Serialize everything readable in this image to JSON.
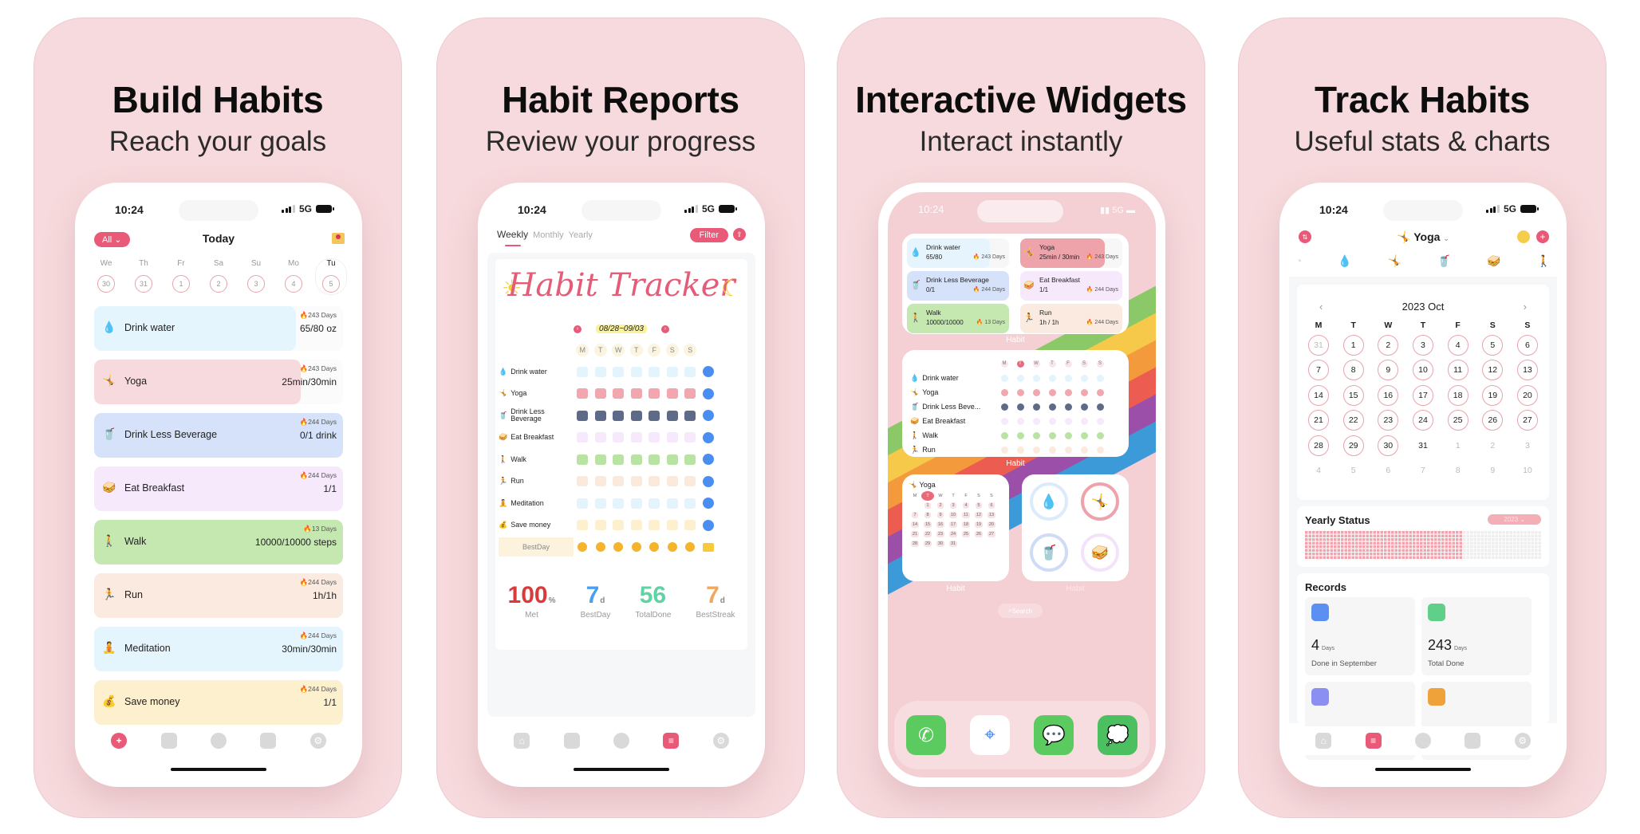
{
  "panels": [
    {
      "title": "Build Habits",
      "subtitle": "Reach your goals"
    },
    {
      "title": "Habit Reports",
      "subtitle": "Review your progress"
    },
    {
      "title": "Interactive Widgets",
      "subtitle": "Interact instantly"
    },
    {
      "title": "Track Habits",
      "subtitle": "Useful stats & charts"
    }
  ],
  "status_bar": {
    "time": "10:24",
    "network": "5G"
  },
  "colors": {
    "accent": "#e85a77",
    "background": "#f7dadd"
  },
  "today_screen": {
    "filter_label": "All",
    "title": "Today",
    "mail_icon": "love-letter-icon",
    "week": [
      {
        "day": "We",
        "date": "30"
      },
      {
        "day": "Th",
        "date": "31"
      },
      {
        "day": "Fr",
        "date": "1"
      },
      {
        "day": "Sa",
        "date": "2"
      },
      {
        "day": "Su",
        "date": "3"
      },
      {
        "day": "Mo",
        "date": "4"
      },
      {
        "day": "Tu",
        "date": "5"
      }
    ],
    "habits": [
      {
        "icon": "💧",
        "name": "Drink water",
        "streak": "243 Days",
        "value": "65/80 oz",
        "progress": 0.81,
        "color": "#e5f5fd"
      },
      {
        "icon": "🤸",
        "name": "Yoga",
        "streak": "243 Days",
        "value": "25min/30min",
        "progress": 0.83,
        "color": "#f7dadd"
      },
      {
        "icon": "🥤",
        "name": "Drink Less Beverage",
        "streak": "244 Days",
        "value": "0/1 drink",
        "progress": 1.0,
        "color": "#d5e2f9"
      },
      {
        "icon": "🥪",
        "name": "Eat Breakfast",
        "streak": "244 Days",
        "value": "1/1",
        "progress": 1.0,
        "color": "#f6e9fb"
      },
      {
        "icon": "🚶",
        "name": "Walk",
        "streak": "13 Days",
        "value": "10000/10000 steps",
        "progress": 1.0,
        "color": "#c5e8b1"
      },
      {
        "icon": "🏃",
        "name": "Run",
        "streak": "244 Days",
        "value": "1h/1h",
        "progress": 1.0,
        "color": "#fbeadf"
      },
      {
        "icon": "🧘",
        "name": "Meditation",
        "streak": "244 Days",
        "value": "30min/30min",
        "progress": 1.0,
        "color": "#e5f5fd"
      },
      {
        "icon": "💰",
        "name": "Save money",
        "streak": "244 Days",
        "value": "1/1",
        "progress": 1.0,
        "color": "#fdf0cf"
      }
    ]
  },
  "report_screen": {
    "tabs": [
      "Weekly",
      "Monthly",
      "Yearly"
    ],
    "filter_label": "Filter",
    "tracker_title": "Habit Tracker",
    "date_range": "08/28~09/03",
    "days": [
      "M",
      "T",
      "W",
      "T",
      "F",
      "S",
      "S"
    ],
    "rows": [
      {
        "icon": "💧",
        "name": "Drink water",
        "color": "#e4f4fc"
      },
      {
        "icon": "🤸",
        "name": "Yoga",
        "color": "#f1a7ad"
      },
      {
        "icon": "🥤",
        "name": "Drink Less Beverage",
        "color": "#5d6b89"
      },
      {
        "icon": "🥪",
        "name": "Eat Breakfast",
        "color": "#f6e9fb"
      },
      {
        "icon": "🚶",
        "name": "Walk",
        "color": "#b8e3a3"
      },
      {
        "icon": "🏃",
        "name": "Run",
        "color": "#fbeadc"
      },
      {
        "icon": "🧘",
        "name": "Meditation",
        "color": "#e4f4fc"
      },
      {
        "icon": "💰",
        "name": "Save money",
        "color": "#fdf0cf"
      }
    ],
    "best_day_label": "BestDay",
    "stats": [
      {
        "value": "100",
        "unit": "%",
        "label": "Met",
        "color": "#d93a3a"
      },
      {
        "value": "7",
        "unit": "d",
        "label": "BestDay",
        "color": "#4b9ff0"
      },
      {
        "value": "56",
        "unit": "",
        "label": "TotalDone",
        "color": "#5fd3a3"
      },
      {
        "value": "7",
        "unit": "d",
        "label": "BestStreak",
        "color": "#f0a760"
      }
    ]
  },
  "widgets_screen": {
    "widget_label": "Habit",
    "small_widgets": [
      {
        "icon": "💧",
        "name": "Drink water",
        "value": "65/80",
        "streak": "243 Days",
        "color": "#e6f5fd",
        "progress": 0.81
      },
      {
        "icon": "🤸",
        "name": "Yoga",
        "value": "25min / 30min",
        "streak": "243 Days",
        "color": "#eea3ab",
        "progress": 0.83
      },
      {
        "icon": "🥤",
        "name": "Drink Less Beverage",
        "value": "0/1",
        "streak": "244 Days",
        "color": "#d5e2f9",
        "progress": 1.0
      },
      {
        "icon": "🥪",
        "name": "Eat Breakfast",
        "value": "1/1",
        "streak": "244 Days",
        "color": "#f6e9fb",
        "progress": 1.0
      },
      {
        "icon": "🚶",
        "name": "Walk",
        "value": "10000/10000",
        "streak": "13 Days",
        "color": "#c5e8b1",
        "progress": 1.0
      },
      {
        "icon": "🏃",
        "name": "Run",
        "value": "1h / 1h",
        "streak": "244 Days",
        "color": "#fbeadf",
        "progress": 1.0
      }
    ],
    "weekly_widget": {
      "days": [
        "M",
        "T",
        "W",
        "T",
        "F",
        "S",
        "S"
      ],
      "today_index": 1,
      "rows": [
        {
          "icon": "💧",
          "name": "Drink water",
          "color": "#e4f4fc"
        },
        {
          "icon": "🤸",
          "name": "Yoga",
          "color": "#f1a7ad"
        },
        {
          "icon": "🥤",
          "name": "Drink Less Beve...",
          "color": "#5d6b89"
        },
        {
          "icon": "🥪",
          "name": "Eat Breakfast",
          "color": "#f6e9fb"
        },
        {
          "icon": "🚶",
          "name": "Walk",
          "color": "#b8e3a3"
        },
        {
          "icon": "🏃",
          "name": "Run",
          "color": "#fbeadc"
        }
      ]
    },
    "calendar_widget": {
      "habit": "Yoga",
      "icon": "🤸",
      "days": [
        "M",
        "T",
        "W",
        "T",
        "F",
        "S",
        "S"
      ],
      "weeks": [
        [
          "",
          "1",
          "2",
          "3",
          "4",
          "5",
          "6"
        ],
        [
          "7",
          "8",
          "9",
          "10",
          "11",
          "12",
          "13"
        ],
        [
          "14",
          "15",
          "16",
          "17",
          "18",
          "19",
          "20"
        ],
        [
          "21",
          "22",
          "23",
          "24",
          "25",
          "26",
          "27"
        ],
        [
          "28",
          "29",
          "30",
          "31",
          "",
          "",
          ""
        ]
      ]
    },
    "ring_widget": [
      {
        "icon": "💧",
        "color": "#dcebfb",
        "progress": 0.81
      },
      {
        "icon": "🤸",
        "color": "#eea3ab",
        "progress": 0.83
      },
      {
        "icon": "🥤",
        "color": "#cfdcf6",
        "progress": 1.0
      },
      {
        "icon": "🥪",
        "color": "#f3e3fa",
        "progress": 1.0
      }
    ],
    "search_label": "Search",
    "dock_apps": [
      {
        "name": "Phone",
        "glyph": "✆",
        "color": "#5ccb5f"
      },
      {
        "name": "Safari",
        "glyph": "⌖",
        "color": "#2f7ef0"
      },
      {
        "name": "Messages",
        "glyph": "💬",
        "color": "#5ccb5f"
      },
      {
        "name": "WeChat",
        "glyph": "💭",
        "color": "#4cc060"
      }
    ]
  },
  "stats_screen": {
    "habit_title": "Yoga",
    "habit_icon": "🤸",
    "habit_tabs": [
      "◔",
      "💧",
      "🤸",
      "🥤",
      "🥪",
      "🚶"
    ],
    "month_label": "2023 Oct",
    "days": [
      "M",
      "T",
      "W",
      "T",
      "F",
      "S",
      "S"
    ],
    "calendar": [
      [
        {
          "d": "31",
          "s": "done-out"
        },
        {
          "d": "1",
          "s": "done"
        },
        {
          "d": "2",
          "s": "done"
        },
        {
          "d": "3",
          "s": "done"
        },
        {
          "d": "4",
          "s": "done"
        },
        {
          "d": "5",
          "s": "done"
        },
        {
          "d": "6",
          "s": "done"
        }
      ],
      [
        {
          "d": "7",
          "s": "done"
        },
        {
          "d": "8",
          "s": "done"
        },
        {
          "d": "9",
          "s": "done"
        },
        {
          "d": "10",
          "s": "done"
        },
        {
          "d": "11",
          "s": "done"
        },
        {
          "d": "12",
          "s": "done"
        },
        {
          "d": "13",
          "s": "done"
        }
      ],
      [
        {
          "d": "14",
          "s": "done"
        },
        {
          "d": "15",
          "s": "done"
        },
        {
          "d": "16",
          "s": "done"
        },
        {
          "d": "17",
          "s": "done"
        },
        {
          "d": "18",
          "s": "done"
        },
        {
          "d": "19",
          "s": "done"
        },
        {
          "d": "20",
          "s": "done"
        }
      ],
      [
        {
          "d": "21",
          "s": "done"
        },
        {
          "d": "22",
          "s": "done"
        },
        {
          "d": "23",
          "s": "done"
        },
        {
          "d": "24",
          "s": "done"
        },
        {
          "d": "25",
          "s": "done"
        },
        {
          "d": "26",
          "s": "done"
        },
        {
          "d": "27",
          "s": "done"
        }
      ],
      [
        {
          "d": "28",
          "s": "done"
        },
        {
          "d": "29",
          "s": "done"
        },
        {
          "d": "30",
          "s": "done"
        },
        {
          "d": "31",
          "s": "none"
        },
        {
          "d": "1",
          "s": "out"
        },
        {
          "d": "2",
          "s": "out"
        },
        {
          "d": "3",
          "s": "out"
        }
      ],
      [
        {
          "d": "4",
          "s": "out"
        },
        {
          "d": "5",
          "s": "out"
        },
        {
          "d": "6",
          "s": "out"
        },
        {
          "d": "7",
          "s": "out"
        },
        {
          "d": "8",
          "s": "out"
        },
        {
          "d": "9",
          "s": "out"
        },
        {
          "d": "10",
          "s": "out"
        }
      ]
    ],
    "yearly_status": {
      "title": "Yearly Status",
      "year": "2023",
      "done_fraction": 0.67
    },
    "records": {
      "title": "Records",
      "items": [
        {
          "value": "4",
          "unit": "Days",
          "label": "Done in September",
          "icon_color": "#5b8ff2"
        },
        {
          "value": "243",
          "unit": "Days",
          "label": "Total Done",
          "icon_color": "#5fcf8a"
        },
        {
          "value": "",
          "unit": "",
          "label": "",
          "icon_color": "#8c8ff2"
        },
        {
          "value": "",
          "unit": "",
          "label": "",
          "icon_color": "#f0a23a"
        }
      ]
    }
  },
  "nav_icons": [
    "home-icon",
    "notes-icon",
    "friends-icon",
    "report-icon",
    "settings-icon"
  ]
}
